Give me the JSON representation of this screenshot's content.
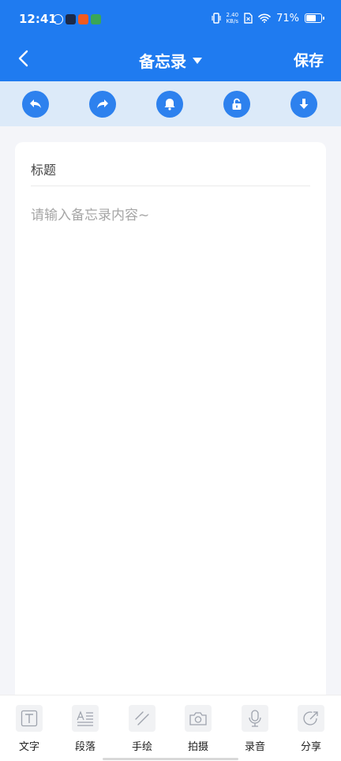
{
  "status_bar": {
    "time": "12:41",
    "net_speed_value": "2.40",
    "net_speed_unit": "KB/s",
    "battery_percent": "71%",
    "battery_level": 0.71
  },
  "navbar": {
    "title": "备忘录",
    "save_label": "保存"
  },
  "toolbar": {
    "icons": [
      "undo-icon",
      "redo-icon",
      "bell-icon",
      "unlock-icon",
      "download-icon"
    ]
  },
  "note": {
    "title": "标题",
    "content_placeholder": "请输入备忘录内容~"
  },
  "bottom_bar": {
    "items": [
      {
        "label": "文字",
        "icon": "text-icon"
      },
      {
        "label": "段落",
        "icon": "paragraph-icon"
      },
      {
        "label": "手绘",
        "icon": "draw-icon"
      },
      {
        "label": "拍摄",
        "icon": "camera-icon"
      },
      {
        "label": "录音",
        "icon": "microphone-icon"
      },
      {
        "label": "分享",
        "icon": "share-icon"
      }
    ]
  },
  "colors": {
    "primary": "#1f7bf0",
    "toolbar_bg": "#dceaf9",
    "page_bg": "#f4f5f9"
  }
}
